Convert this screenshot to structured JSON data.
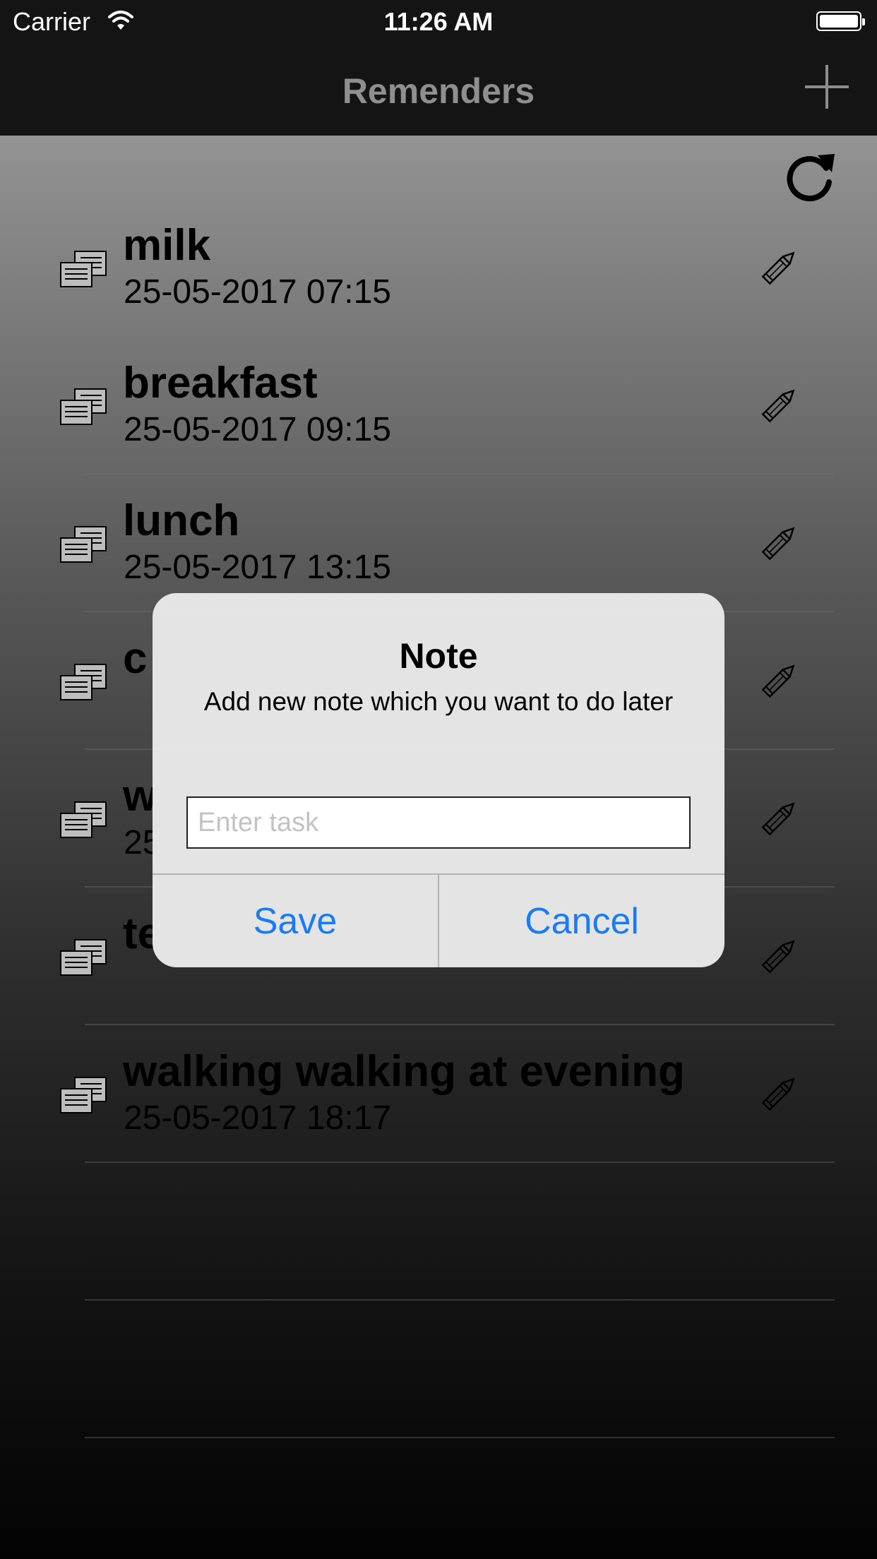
{
  "status_bar": {
    "carrier": "Carrier",
    "time": "11:26 AM"
  },
  "nav": {
    "title": "Remenders",
    "add_icon": "plus-icon"
  },
  "refresh_icon": "refresh-icon",
  "reminders": [
    {
      "title": "milk",
      "date": "25-05-2017 07:15"
    },
    {
      "title": "breakfast",
      "date": "25-05-2017 09:15"
    },
    {
      "title": "lunch",
      "date": "25-05-2017 13:15"
    },
    {
      "title": "c",
      "date": ""
    },
    {
      "title": "w",
      "date": "25"
    },
    {
      "title": "te",
      "date": ""
    },
    {
      "title": "walking walking at evening",
      "date": "25-05-2017 18:17"
    },
    {
      "title": "",
      "date": ""
    },
    {
      "title": "",
      "date": ""
    }
  ],
  "dialog": {
    "title": "Note",
    "message": "Add new note which you want to do later",
    "input_placeholder": "Enter task",
    "input_value": "",
    "save_label": "Save",
    "cancel_label": "Cancel",
    "accent_color": "#1a7cf4"
  }
}
